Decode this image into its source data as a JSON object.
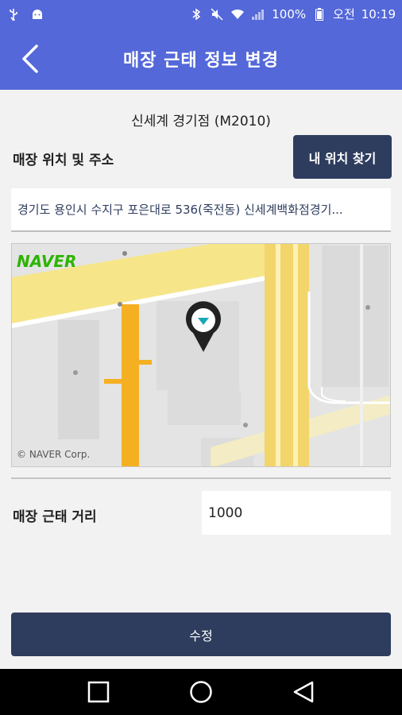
{
  "status_bar": {
    "battery": "100%",
    "ampm": "오전",
    "time": "10:19"
  },
  "header": {
    "title": "매장 근태 정보 변경"
  },
  "store": {
    "name": "신세계 경기점 (M2010)"
  },
  "location": {
    "label": "매장 위치 및 주소",
    "find_button": "내 위치 찾기",
    "address": "경기도 용인시 수지구 포은대로 536(죽전동) 신세계백화점경기..."
  },
  "map": {
    "logo": "NAVER",
    "copyright": "© NAVER Corp."
  },
  "distance": {
    "label": "매장 근태 거리",
    "value": "1000"
  },
  "actions": {
    "submit_label": "수정"
  },
  "colors": {
    "primary": "#5468d9",
    "dark_button": "#2e3d5e",
    "naver_green": "#2db400",
    "marker_teal": "#1aa7b8"
  }
}
